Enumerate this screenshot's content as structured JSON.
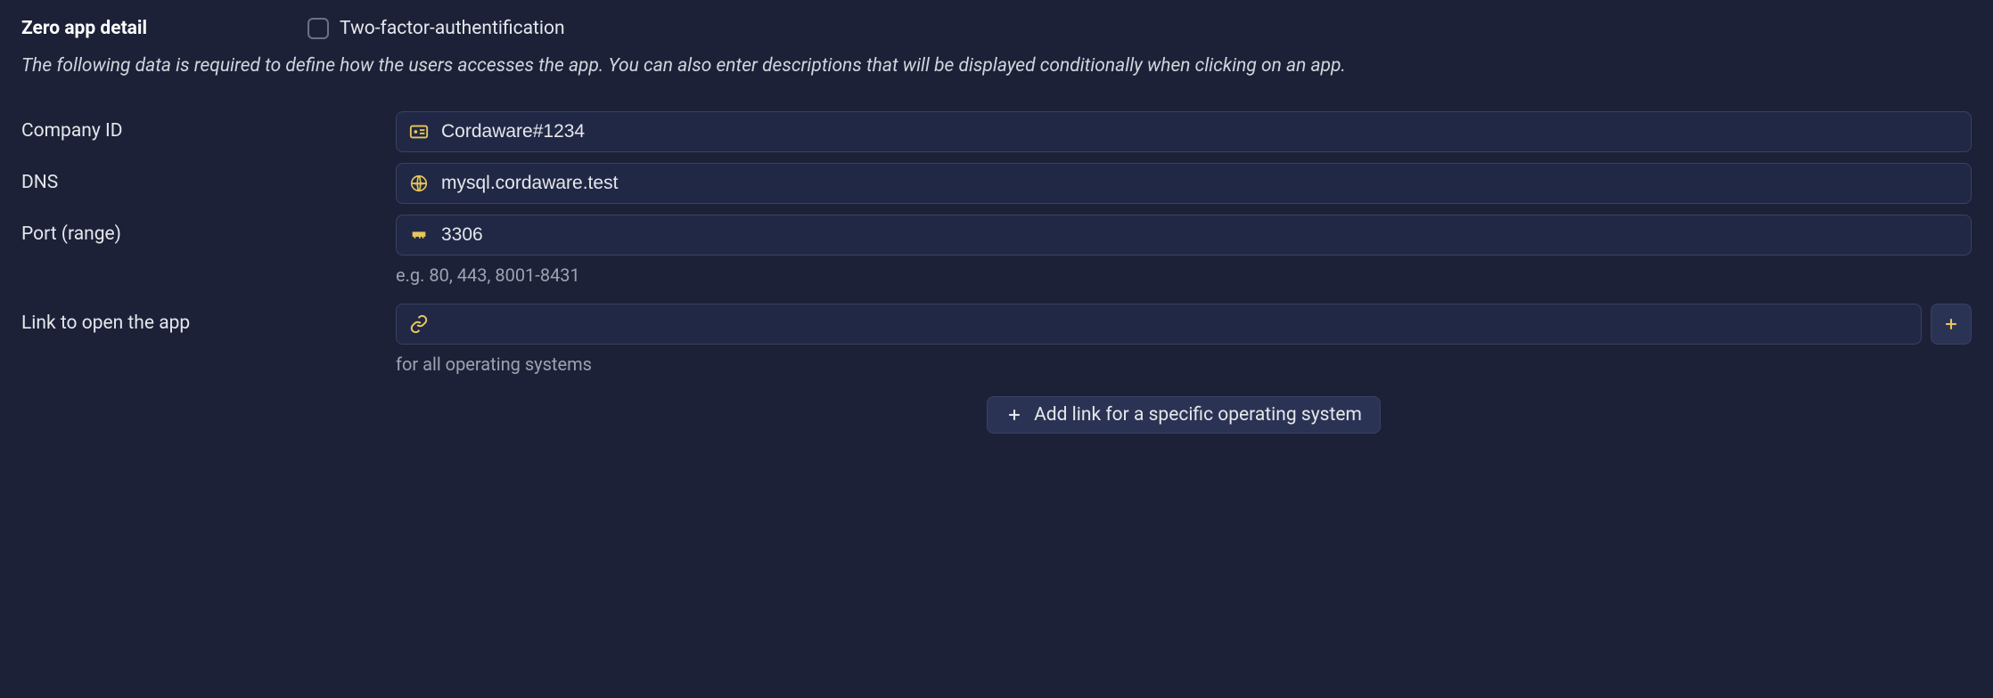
{
  "section": {
    "title": "Zero app detail",
    "twoFactorLabel": "Two-factor-authentification",
    "description": "The following data is required to define how the users accesses the app. You can also enter descriptions that will be displayed conditionally when clicking on an app."
  },
  "form": {
    "companyId": {
      "label": "Company ID",
      "value": "Cordaware#1234"
    },
    "dns": {
      "label": "DNS",
      "value": "mysql.cordaware.test"
    },
    "port": {
      "label": "Port (range)",
      "value": "3306",
      "hint": "e.g. 80, 443, 8001-8431"
    },
    "link": {
      "label": "Link to open the app",
      "value": "",
      "hint": "for all operating systems"
    }
  },
  "buttons": {
    "addOsLink": "Add link for a specific operating system"
  }
}
